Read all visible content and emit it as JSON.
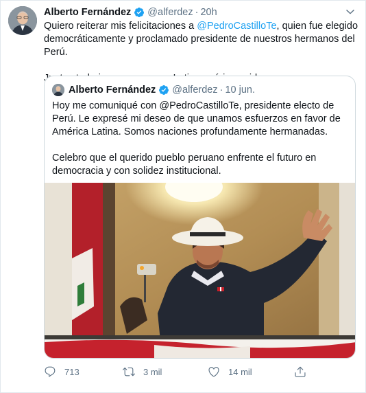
{
  "tweet": {
    "author_name": "Alberto Fernández",
    "handle": "@alferdez",
    "separator": "·",
    "time": "20h",
    "text_before_link": "Quiero reiterar mis felicitaciones a ",
    "link": "@PedroCastilloTe",
    "text_after_link": ", quien fue elegido democráticamente y proclamado presidente de nuestros hermanos del Perú.",
    "text_paragraph_2": "Juntos trabajaremos por una Latinoamérica unida."
  },
  "quote": {
    "author_name": "Alberto Fernández",
    "handle": "@alferdez",
    "separator": "·",
    "time": "10 jun.",
    "paragraph_1": "Hoy me comuniqué con @PedroCastilloTe, presidente electo de Perú. Le expresé mi deseo de que unamos esfuerzos en favor de América Latina. Somos naciones profundamente hermanadas.",
    "paragraph_2": "Celebro que el querido pueblo peruano enfrente el futuro en democracia y con solidez institucional."
  },
  "actions": {
    "reply_count": "713",
    "retweet_count": "3 mil",
    "like_count": "14 mil"
  },
  "icons": {
    "verified": "verified-badge-icon",
    "more": "chevron-down-icon",
    "reply": "reply-icon",
    "retweet": "retweet-icon",
    "like": "heart-icon",
    "share": "share-icon"
  },
  "colors": {
    "link": "#1da1f2",
    "secondary_text": "#5b7083",
    "border": "#cfd9de"
  }
}
